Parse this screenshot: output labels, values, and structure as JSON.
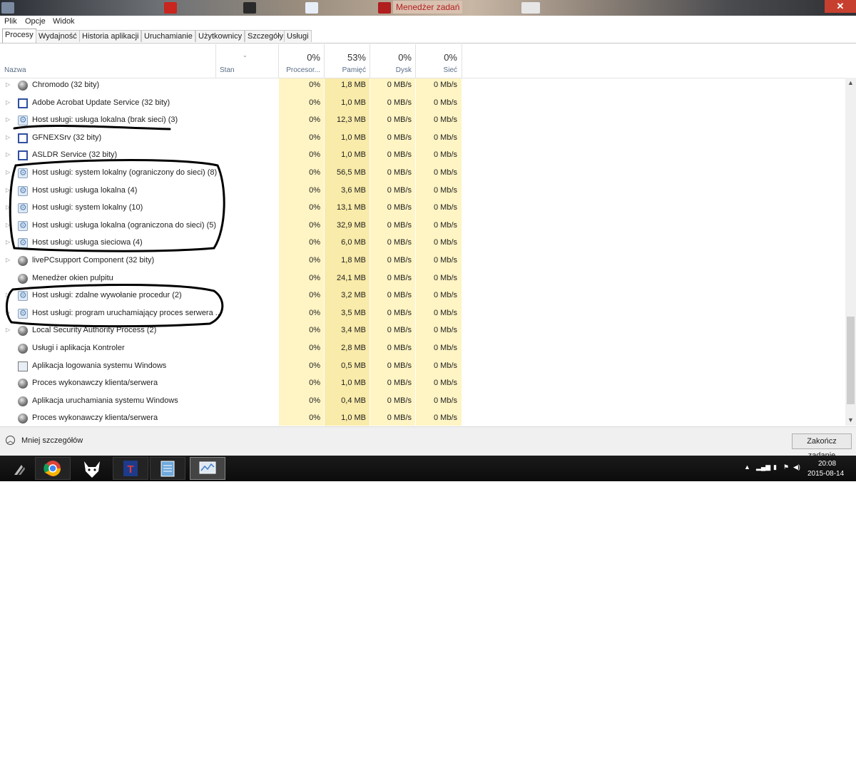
{
  "window": {
    "title": "Menedżer zadań",
    "close_glyph": "✕"
  },
  "menu": {
    "items": [
      "Plik",
      "Opcje",
      "Widok"
    ]
  },
  "tabs": [
    "Procesy",
    "Wydajność",
    "Historia aplikacji",
    "Uruchamianie",
    "Użytkownicy",
    "Szczegóły",
    "Usługi"
  ],
  "active_tab": "Procesy",
  "columns": {
    "name": "Nazwa",
    "status": "Stan",
    "cpu": {
      "label": "Procesor...",
      "total": "0%"
    },
    "memory": {
      "label": "Pamięć",
      "total": "53%"
    },
    "disk": {
      "label": "Dysk",
      "total": "0%"
    },
    "network": {
      "label": "Sieć",
      "total": "0%"
    }
  },
  "processes": [
    {
      "name": "Chromodo (32 bity)",
      "icon": "globe-icon",
      "expandable": true,
      "cpu": "0%",
      "mem": "1,8 MB",
      "disk": "0 MB/s",
      "net": "0 Mb/s"
    },
    {
      "name": "Adobe Acrobat Update Service (32 bity)",
      "icon": "window-icon",
      "expandable": true,
      "cpu": "0%",
      "mem": "1,0 MB",
      "disk": "0 MB/s",
      "net": "0 Mb/s"
    },
    {
      "name": "Host usługi: usługa lokalna (brak sieci) (3)",
      "icon": "gear-icon",
      "expandable": true,
      "cpu": "0%",
      "mem": "12,3 MB",
      "disk": "0 MB/s",
      "net": "0 Mb/s"
    },
    {
      "name": "GFNEXSrv (32 bity)",
      "icon": "window-icon",
      "expandable": true,
      "cpu": "0%",
      "mem": "1,0 MB",
      "disk": "0 MB/s",
      "net": "0 Mb/s"
    },
    {
      "name": "ASLDR Service (32 bity)",
      "icon": "window-icon",
      "expandable": true,
      "cpu": "0%",
      "mem": "1,0 MB",
      "disk": "0 MB/s",
      "net": "0 Mb/s"
    },
    {
      "name": "Host usługi: system lokalny (ograniczony do sieci) (8)",
      "icon": "gear-icon",
      "expandable": true,
      "cpu": "0%",
      "mem": "56,5 MB",
      "disk": "0 MB/s",
      "net": "0 Mb/s"
    },
    {
      "name": "Host usługi: usługa lokalna (4)",
      "icon": "gear-icon",
      "expandable": true,
      "cpu": "0%",
      "mem": "3,6 MB",
      "disk": "0 MB/s",
      "net": "0 Mb/s"
    },
    {
      "name": "Host usługi: system lokalny (10)",
      "icon": "gear-icon",
      "expandable": true,
      "cpu": "0%",
      "mem": "13,1 MB",
      "disk": "0 MB/s",
      "net": "0 Mb/s"
    },
    {
      "name": "Host usługi: usługa lokalna (ograniczona do sieci) (5)",
      "icon": "gear-icon",
      "expandable": true,
      "cpu": "0%",
      "mem": "32,9 MB",
      "disk": "0 MB/s",
      "net": "0 Mb/s"
    },
    {
      "name": "Host usługi: usługa sieciowa (4)",
      "icon": "gear-icon",
      "expandable": true,
      "cpu": "0%",
      "mem": "6,0 MB",
      "disk": "0 MB/s",
      "net": "0 Mb/s"
    },
    {
      "name": "livePCsupport Component (32 bity)",
      "icon": "globe-icon",
      "expandable": true,
      "cpu": "0%",
      "mem": "1,8 MB",
      "disk": "0 MB/s",
      "net": "0 Mb/s"
    },
    {
      "name": "Menedżer okien pulpitu",
      "icon": "globe-icon",
      "expandable": false,
      "cpu": "0%",
      "mem": "24,1 MB",
      "disk": "0 MB/s",
      "net": "0 Mb/s"
    },
    {
      "name": "Host usługi: zdalne wywołanie procedur (2)",
      "icon": "gear-icon",
      "expandable": true,
      "cpu": "0%",
      "mem": "3,2 MB",
      "disk": "0 MB/s",
      "net": "0 Mb/s"
    },
    {
      "name": "Host usługi: program uruchamiający proces serwera ...",
      "icon": "gear-icon",
      "expandable": true,
      "cpu": "0%",
      "mem": "3,5 MB",
      "disk": "0 MB/s",
      "net": "0 Mb/s"
    },
    {
      "name": "Local Security Authority Process (2)",
      "icon": "globe-icon",
      "expandable": true,
      "cpu": "0%",
      "mem": "3,4 MB",
      "disk": "0 MB/s",
      "net": "0 Mb/s"
    },
    {
      "name": "Usługi i aplikacja Kontroler",
      "icon": "globe-icon",
      "expandable": false,
      "cpu": "0%",
      "mem": "2,8 MB",
      "disk": "0 MB/s",
      "net": "0 Mb/s"
    },
    {
      "name": "Aplikacja logowania systemu Windows",
      "icon": "app-icon",
      "expandable": false,
      "cpu": "0%",
      "mem": "0,5 MB",
      "disk": "0 MB/s",
      "net": "0 Mb/s"
    },
    {
      "name": "Proces wykonawczy klienta/serwera",
      "icon": "globe-icon",
      "expandable": false,
      "cpu": "0%",
      "mem": "1,0 MB",
      "disk": "0 MB/s",
      "net": "0 Mb/s"
    },
    {
      "name": "Aplikacja uruchamiania systemu Windows",
      "icon": "globe-icon",
      "expandable": false,
      "cpu": "0%",
      "mem": "0,4 MB",
      "disk": "0 MB/s",
      "net": "0 Mb/s"
    },
    {
      "name": "Proces wykonawczy klienta/serwera",
      "icon": "globe-icon",
      "expandable": false,
      "cpu": "0%",
      "mem": "1,0 MB",
      "disk": "0 MB/s",
      "net": "0 Mb/s"
    }
  ],
  "footer": {
    "fewer_details": "Mniej szczegółów",
    "end_task": "Zakończ zadanie"
  },
  "taskbar": {
    "apps": [
      "start-icon",
      "chrome-icon",
      "fox-icon",
      "text-app-icon",
      "notepad-icon",
      "task-manager-icon"
    ],
    "time": "20:08",
    "date": "2015-08-14"
  },
  "colors": {
    "cpu_col": "#fff4c4",
    "mem_col": "#f9eba9",
    "disk_col": "#fff4c4",
    "net_col": "#fff4c4",
    "header_label": "#5a6c85",
    "annotation_ink": "#000000"
  }
}
